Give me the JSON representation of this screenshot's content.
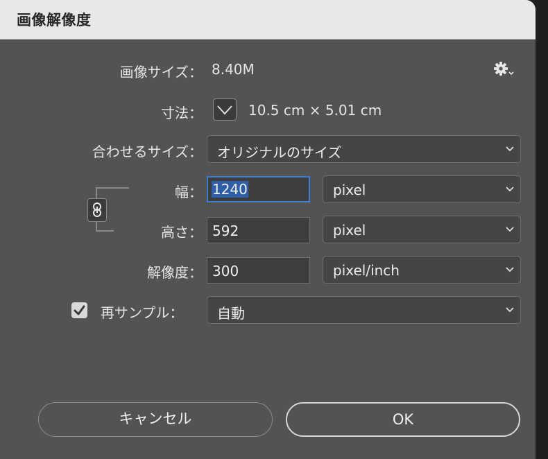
{
  "window": {
    "title": "画像解像度"
  },
  "image_size": {
    "label": "画像サイズ：",
    "value": "8.40M"
  },
  "dimensions": {
    "label": "寸法：",
    "value": "10.5 cm × 5.01 cm"
  },
  "fit_to": {
    "label": "合わせるサイズ：",
    "selected": "オリジナルのサイズ"
  },
  "width": {
    "label": "幅：",
    "value": "1240",
    "unit": "pixel"
  },
  "height": {
    "label": "高さ：",
    "value": "592",
    "unit": "pixel"
  },
  "resolution": {
    "label": "解像度：",
    "value": "300",
    "unit": "pixel/inch"
  },
  "resample": {
    "label": "再サンプル：",
    "checked": true,
    "selected": "自動"
  },
  "buttons": {
    "cancel": "キャンセル",
    "ok": "OK"
  },
  "icons": {
    "settings": "gear-icon",
    "dimensions": "chevron-down-icon",
    "constrain": "link-chain-icon",
    "checkbox": "checkmark-icon"
  },
  "colors": {
    "dialog_bg": "#535353",
    "titlebar_bg": "#e8e8e8",
    "focus": "#3f7ed6",
    "selection": "#2e5fa8"
  }
}
